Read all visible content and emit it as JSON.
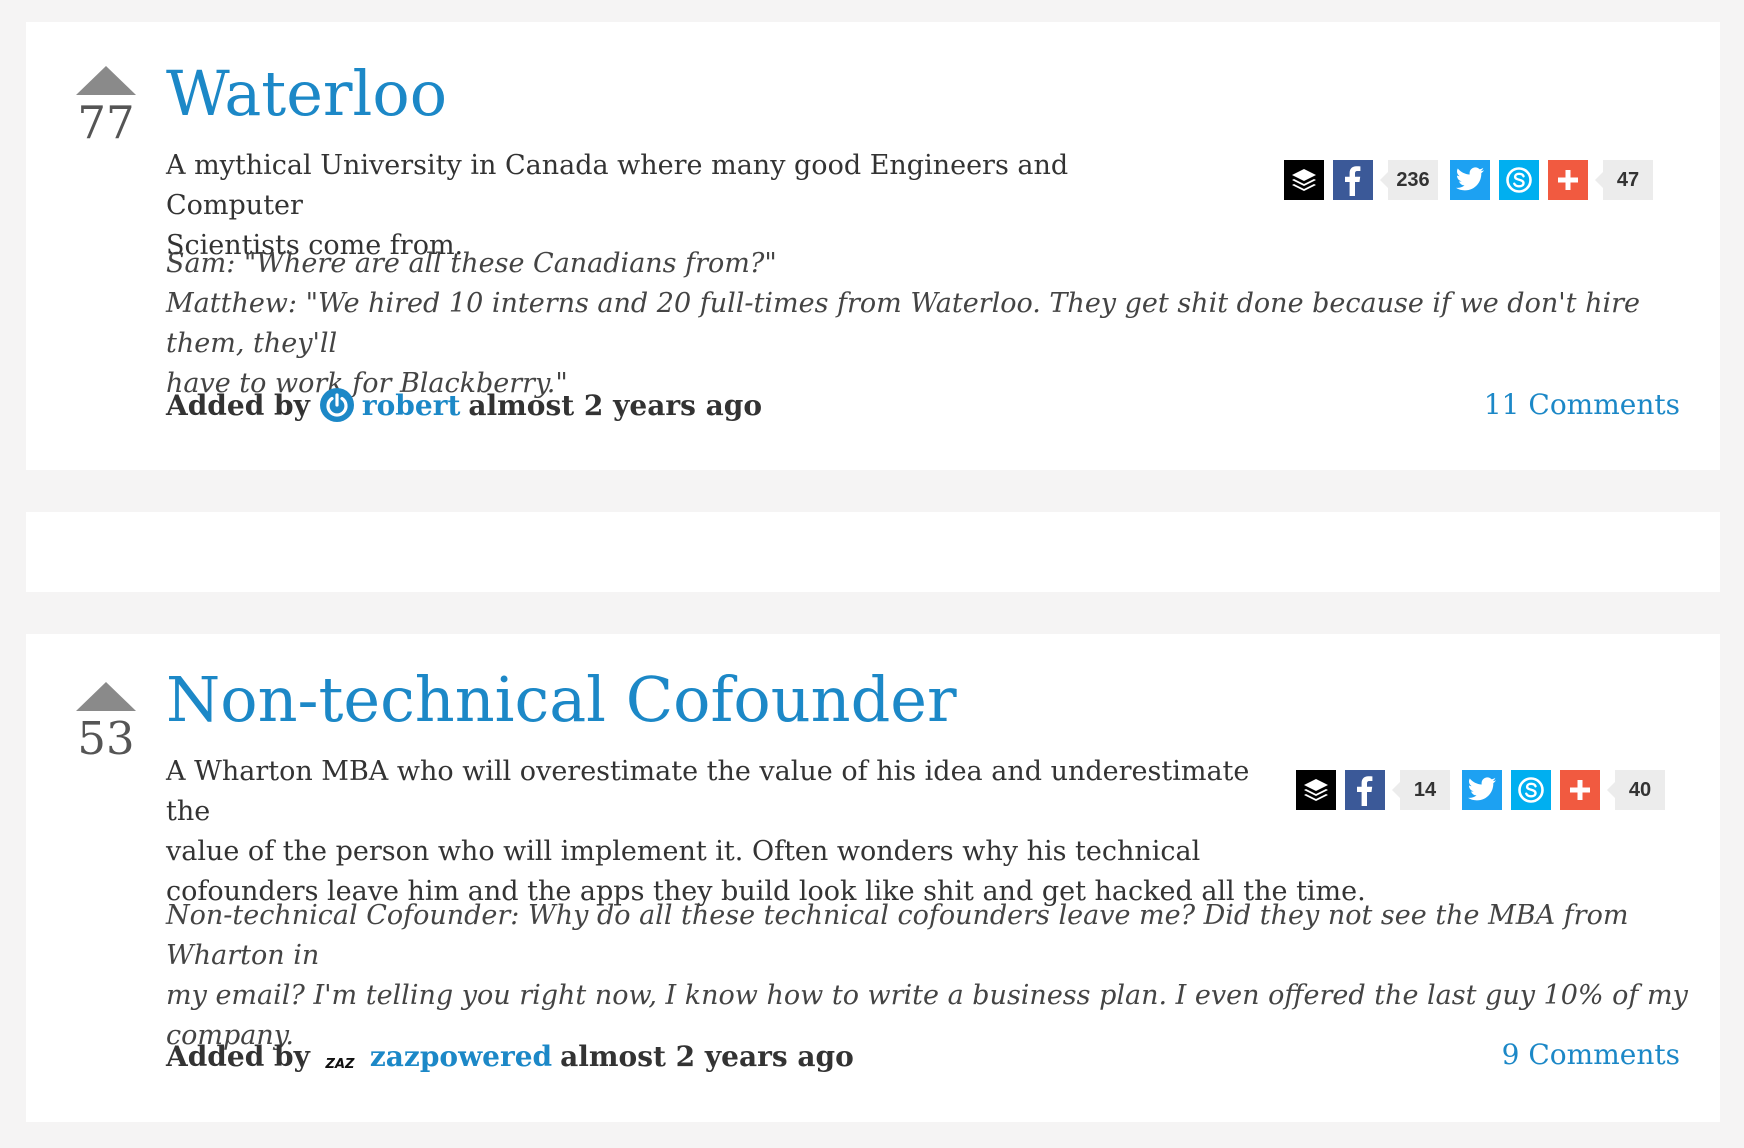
{
  "colors": {
    "page_background": "#f5f4f4",
    "card_background": "#ffffff",
    "title_link": "#1c88c7",
    "vote_arrow": "#8a8a8a",
    "buffer": "#000000",
    "facebook": "#3b5998",
    "twitter": "#1da1f2",
    "skype": "#00aff0",
    "plus": "#f15a40",
    "share_count_bg": "#ececec"
  },
  "entries": [
    {
      "votes": "77",
      "title": "Waterloo",
      "description_lines": [
        "A mythical University in Canada where many good Engineers and Computer",
        "Scientists come from."
      ],
      "quote_lines": [
        "Sam: \"Where are all these Canadians from?\"",
        "Matthew: \"We hired 10 interns and 20 full-times from Waterloo. They get shit done because if we don't hire them, they'll",
        "have to work for Blackberry.\""
      ],
      "added_by_label": "Added by",
      "author": "robert",
      "author_avatar_icon": "power-icon",
      "time_ago": "almost 2 years ago",
      "comments_link": "11 Comments",
      "share": {
        "icons": [
          "buffer-icon",
          "facebook-icon",
          "twitter-icon",
          "skype-icon",
          "plus-icon"
        ],
        "facebook_count": "236",
        "total_count": "47"
      }
    },
    {
      "votes": "53",
      "title": "Non-technical Cofounder",
      "description_lines": [
        "A Wharton MBA who will overestimate the value of his idea and underestimate the",
        "value of the person who will implement it. Often wonders why his technical",
        "cofounders leave him and the apps they build look like shit and get hacked all the time."
      ],
      "quote_lines": [
        "Non-technical Cofounder: Why do all these technical cofounders leave me? Did they not see the MBA from Wharton in",
        "my email? I'm telling you right now, I know how to write a business plan. I even offered the last guy 10% of my",
        "company."
      ],
      "added_by_label": "Added by",
      "author": "zazpowered",
      "author_avatar_icon": "zaz-logo-icon",
      "author_avatar_text": "ZAZ",
      "time_ago": "almost 2 years ago",
      "comments_link": "9 Comments",
      "share": {
        "icons": [
          "buffer-icon",
          "facebook-icon",
          "twitter-icon",
          "skype-icon",
          "plus-icon"
        ],
        "facebook_count": "14",
        "total_count": "40"
      }
    }
  ]
}
